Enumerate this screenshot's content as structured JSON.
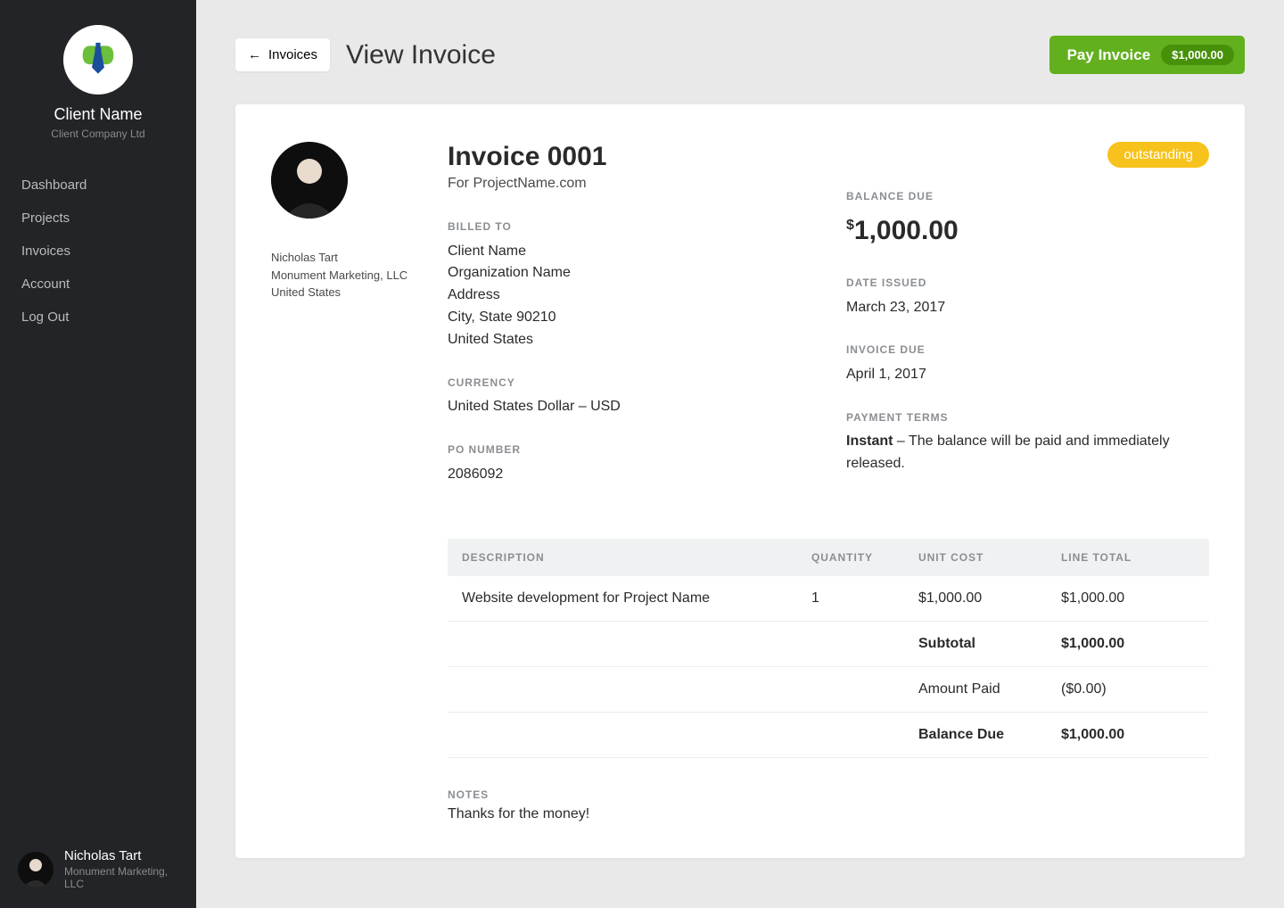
{
  "sidebar": {
    "client_name": "Client Name",
    "client_company": "Client Company Ltd",
    "nav": [
      "Dashboard",
      "Projects",
      "Invoices",
      "Account",
      "Log Out"
    ],
    "footer_name": "Nicholas Tart",
    "footer_company": "Monument Marketing, LLC"
  },
  "topbar": {
    "back_label": "Invoices",
    "page_title": "View Invoice",
    "pay_label": "Pay Invoice",
    "pay_amount": "$1,000.00"
  },
  "invoice": {
    "title": "Invoice 0001",
    "subtitle": "For ProjectName.com",
    "status": "outstanding",
    "sender": {
      "name": "Nicholas Tart",
      "company": "Monument Marketing, LLC",
      "country": "United States"
    },
    "billed_to_label": "BILLED TO",
    "billed_to": {
      "name": "Client Name",
      "org": "Organization Name",
      "address": "Address",
      "city_line": "City, State 90210",
      "country": "United States"
    },
    "currency_label": "CURRENCY",
    "currency": "United States Dollar – USD",
    "po_label": "PO NUMBER",
    "po_number": "2086092",
    "balance_label": "BALANCE DUE",
    "balance_currency_symbol": "$",
    "balance_amount": "1,000.00",
    "date_issued_label": "DATE ISSUED",
    "date_issued": "March 23, 2017",
    "invoice_due_label": "INVOICE DUE",
    "invoice_due": "April 1, 2017",
    "payment_terms_label": "PAYMENT TERMS",
    "payment_terms_name": "Instant",
    "payment_terms_desc": " – The balance will be paid and immediately released.",
    "table": {
      "headers": {
        "desc": "DESCRIPTION",
        "qty": "QUANTITY",
        "unit": "UNIT COST",
        "total": "LINE TOTAL"
      },
      "rows": [
        {
          "desc": "Website development for Project Name",
          "qty": "1",
          "unit": "$1,000.00",
          "total": "$1,000.00"
        }
      ],
      "summary": [
        {
          "label": "Subtotal",
          "value": "$1,000.00",
          "bold": true
        },
        {
          "label": "Amount Paid",
          "value": "($0.00)",
          "bold": false
        },
        {
          "label": "Balance Due",
          "value": "$1,000.00",
          "bold": true
        }
      ]
    },
    "notes_label": "NOTES",
    "notes": "Thanks for the money!"
  }
}
